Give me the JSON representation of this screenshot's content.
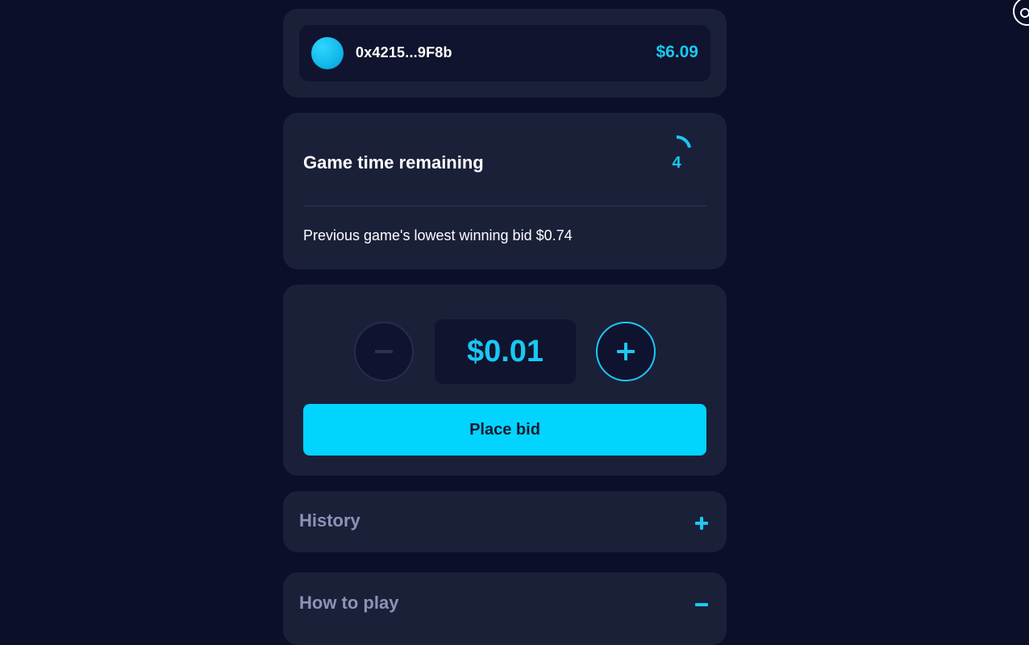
{
  "wallet": {
    "address": "0x4215...9F8b",
    "balance": "$6.09"
  },
  "timer": {
    "title": "Game time remaining",
    "value": "4",
    "previous_bid_text": "Previous game's lowest winning bid $0.74"
  },
  "bid": {
    "amount": "$0.01",
    "place_bid_label": "Place bid"
  },
  "accordion": {
    "history_label": "History",
    "howto_label": "How to play"
  },
  "colors": {
    "background": "#0b0f2a",
    "card": "#1b2039",
    "accent": "#00d4ff"
  },
  "icons": {
    "decrement": "minus-icon",
    "increment": "plus-icon",
    "history_toggle": "plus-icon",
    "howto_toggle": "minus-icon"
  }
}
